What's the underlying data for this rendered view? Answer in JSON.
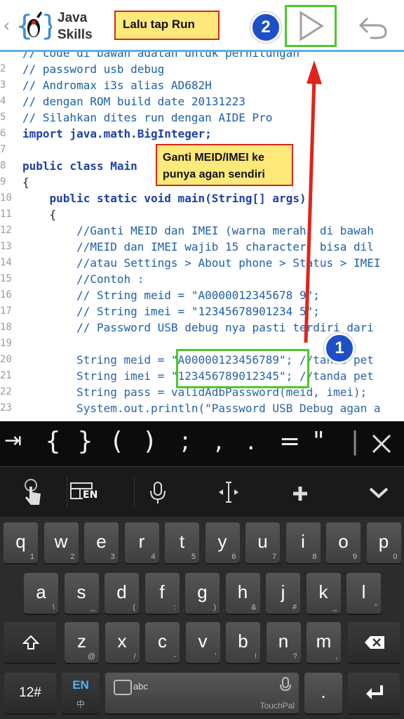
{
  "header": {
    "back_icon": "chevron-left-icon",
    "app_name_line1": "Java",
    "app_name_line2": "Skills",
    "callout_run": "Lalu tap Run",
    "badge_2": "2",
    "run_icon": "play-icon",
    "undo_icon": "undo-icon"
  },
  "editor": {
    "lines": [
      {
        "n": "",
        "text": "// code di bawah adalah untuk perhitungan"
      },
      {
        "n": "2",
        "text": "// password usb debug"
      },
      {
        "n": "3",
        "text": "// Andromax i3s alias AD682H"
      },
      {
        "n": "4",
        "text": "// dengan ROM build date 20131223"
      },
      {
        "n": "5",
        "text": "// Silahkan dites run dengan AIDE Pro"
      },
      {
        "n": "6",
        "text": "import java.math.BigInteger;"
      },
      {
        "n": "7",
        "text": ""
      },
      {
        "n": "8",
        "text": "public class Main"
      },
      {
        "n": "9",
        "text": "{"
      },
      {
        "n": "10",
        "text": "    public static void main(String[] args)"
      },
      {
        "n": "11",
        "text": "    {"
      },
      {
        "n": "12",
        "text": "        //Ganti MEID dan IMEI (warna merah) di bawah"
      },
      {
        "n": "13",
        "text": "        //MEID dan IMEI wajib 15 character, bisa dil"
      },
      {
        "n": "14",
        "text": "        //atau Settings > About phone > Status > IMEI"
      },
      {
        "n": "15",
        "text": "        //Contoh :"
      },
      {
        "n": "16",
        "text": "        // String meid = \"A0000012345678 9\";"
      },
      {
        "n": "17",
        "text": "        // String imei = \"12345678901234 5\";"
      },
      {
        "n": "18",
        "text": "        // Password USB debug nya pasti terdiri dari"
      },
      {
        "n": "19",
        "text": ""
      },
      {
        "n": "20",
        "text": "        String meid = \"A00000123456789\"; //tanda pet"
      },
      {
        "n": "21",
        "text": "        String imei = \"123456789012345\"; //tanda pet"
      },
      {
        "n": "22",
        "text": "        String pass = validAdbPassword(meid, imei);"
      },
      {
        "n": "23",
        "text": "        System.out.println(\"Password USB Debug agan a"
      }
    ],
    "callout_meid_line1": "Ganti MEID/IMEI ke",
    "callout_meid_line2": "punya agan sendiri",
    "badge_1": "1"
  },
  "symbol_bar": {
    "tab_icon": "tab-arrow-icon",
    "symbols": [
      "{",
      "}",
      "(",
      ")",
      ";",
      ",",
      ".",
      "=",
      "\""
    ],
    "close_icon": "close-icon"
  },
  "tool_row": {
    "items": [
      {
        "icon": "touch-hand-icon"
      },
      {
        "icon": "keyboard-layout-icon",
        "label": "EN"
      },
      {
        "icon": "microphone-icon"
      },
      {
        "icon": "cursor-move-icon"
      },
      {
        "icon": "plus-icon"
      },
      {
        "icon": "chevron-down-icon"
      }
    ]
  },
  "keyboard": {
    "row1": [
      {
        "k": "q",
        "s": "1"
      },
      {
        "k": "w",
        "s": "2"
      },
      {
        "k": "e",
        "s": "3"
      },
      {
        "k": "r",
        "s": "4"
      },
      {
        "k": "t",
        "s": "5"
      },
      {
        "k": "y",
        "s": "6"
      },
      {
        "k": "u",
        "s": "7"
      },
      {
        "k": "i",
        "s": "8"
      },
      {
        "k": "o",
        "s": "9"
      },
      {
        "k": "p",
        "s": "0"
      }
    ],
    "row2": [
      {
        "k": "a",
        "s": "\\"
      },
      {
        "k": "s",
        "s": "_"
      },
      {
        "k": "d",
        "s": "("
      },
      {
        "k": "f",
        "s": ":"
      },
      {
        "k": "g",
        "s": ")"
      },
      {
        "k": "h",
        "s": "&"
      },
      {
        "k": "j",
        "s": "#"
      },
      {
        "k": "k",
        "s": "_"
      },
      {
        "k": "l",
        "s": "\""
      }
    ],
    "row3": [
      {
        "k": "z",
        "s": "@"
      },
      {
        "k": "x",
        "s": "/"
      },
      {
        "k": "c",
        "s": "-"
      },
      {
        "k": "v",
        "s": "'"
      },
      {
        "k": "b",
        "s": "!"
      },
      {
        "k": "n",
        "s": "?"
      },
      {
        "k": "m",
        "s": ","
      }
    ],
    "shift_icon": "shift-icon",
    "backspace_icon": "backspace-icon",
    "num_key": "12#",
    "lang_key": "EN",
    "lang_sub": "中",
    "space_label": "abc",
    "space_brand": "TouchPal",
    "period_key": ".",
    "enter_icon": "enter-icon"
  },
  "colors": {
    "callout_fill": "#ffe97a",
    "callout_border": "#d8261c",
    "highlight_green": "#4ec82a",
    "badge_blue": "#1f4fc7",
    "arrow_red": "#e0241b",
    "header_accent": "#5ab0e6",
    "keyboard_bg": "#2c2c2c"
  }
}
